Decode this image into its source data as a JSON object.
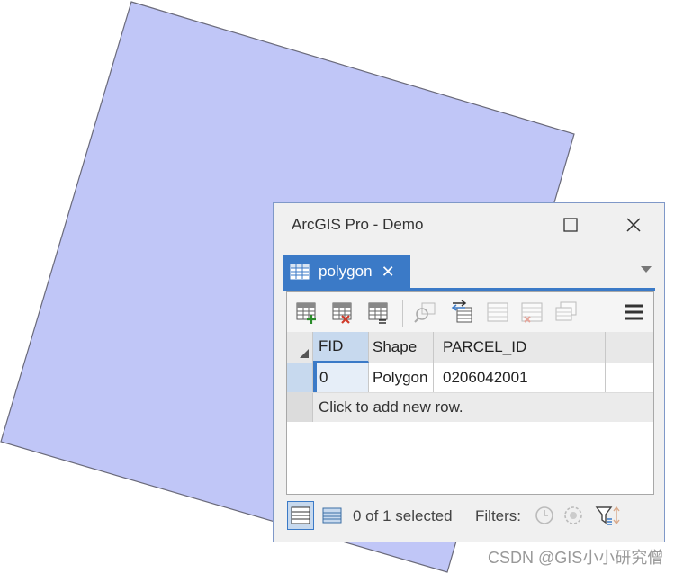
{
  "window": {
    "title": "ArcGIS Pro - Demo"
  },
  "tab": {
    "label": "polygon",
    "close_glyph": "✕"
  },
  "toolbar": {
    "icons": [
      "add-field-icon",
      "delete-field-icon",
      "calculate-field-icon",
      "zoom-to-icon",
      "switch-selection-icon",
      "select-all-icon",
      "clear-selection-icon",
      "delete-selected-icon",
      "copy-selected-icon",
      "menu-icon"
    ]
  },
  "table": {
    "columns": [
      "FID",
      "Shape",
      "PARCEL_ID"
    ],
    "rows": [
      {
        "FID": "0",
        "Shape": "Polygon",
        "PARCEL_ID": "0206042001"
      }
    ],
    "new_row_text": "Click to add new row."
  },
  "status": {
    "selection": "0 of 1 selected",
    "filters_label": "Filters:"
  },
  "watermark": "CSDN @GIS小小研究僧",
  "colors": {
    "polygon_fill": "#c0c6f7",
    "polygon_stroke": "#6a6a7a",
    "accent": "#3b7ac7"
  }
}
